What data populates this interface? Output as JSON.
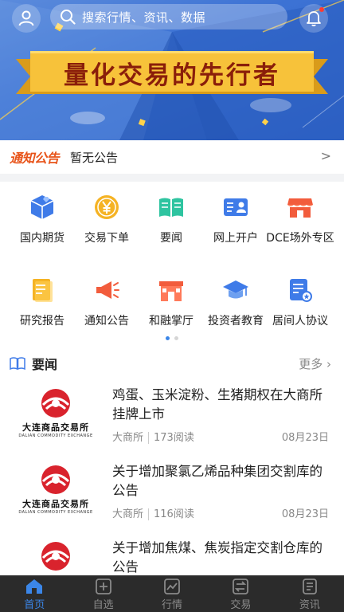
{
  "header": {
    "search_placeholder": "搜索行情、资讯、数据",
    "banner_slogan": "量化交易的先行者"
  },
  "notice": {
    "tag": "通知公告",
    "text": "暂无公告",
    "arrow": ">"
  },
  "menu": {
    "items": [
      {
        "label": "国内期货",
        "icon": "diamond-box-icon",
        "color": "#3f7be8"
      },
      {
        "label": "交易下单",
        "icon": "yen-coin-icon",
        "color": "#f5b324"
      },
      {
        "label": "要闻",
        "icon": "open-book-icon",
        "color": "#2ec4a0"
      },
      {
        "label": "网上开户",
        "icon": "id-card-icon",
        "color": "#3f7be8"
      },
      {
        "label": "DCE场外专区",
        "icon": "storefront-icon",
        "color": "#f25c3c"
      },
      {
        "label": "研究报告",
        "icon": "report-icon",
        "color": "#f5b324"
      },
      {
        "label": "通知公告",
        "icon": "megaphone-icon",
        "color": "#f25c3c"
      },
      {
        "label": "和融掌厅",
        "icon": "shop-hall-icon",
        "color": "#f25c3c"
      },
      {
        "label": "投资者教育",
        "icon": "graduation-cap-icon",
        "color": "#3f7be8"
      },
      {
        "label": "居间人协议",
        "icon": "agreement-icon",
        "color": "#3f7be8"
      }
    ],
    "page_count": 2,
    "active_page": 1
  },
  "news": {
    "section_title": "要闻",
    "more_label": "更多",
    "logo_cn": "大连商品交易所",
    "logo_en": "DALIAN COMMODITY EXCHANGE",
    "items": [
      {
        "title": "鸡蛋、玉米淀粉、生猪期权在大商所挂牌上市",
        "source": "大商所",
        "reads": "173阅读",
        "date": "08月23日"
      },
      {
        "title": "关于增加聚氯乙烯品种集团交割库的公告",
        "source": "大商所",
        "reads": "116阅读",
        "date": "08月23日"
      },
      {
        "title": "关于增加焦煤、焦炭指定交割仓库的公告",
        "source": "",
        "reads": "",
        "date": ""
      }
    ]
  },
  "tabbar": {
    "tabs": [
      {
        "label": "首页",
        "icon": "home-icon",
        "active": true
      },
      {
        "label": "自选",
        "icon": "add-square-icon",
        "active": false
      },
      {
        "label": "行情",
        "icon": "chart-line-icon",
        "active": false
      },
      {
        "label": "交易",
        "icon": "exchange-icon",
        "active": false
      },
      {
        "label": "资讯",
        "icon": "news-doc-icon",
        "active": false
      }
    ]
  },
  "colors": {
    "accent": "#3b86e8",
    "banner_blue": "#3c72d4",
    "ribbon_gold": "#f7c23a",
    "notice_orange": "#e8541a",
    "tabbar_bg": "#2b2b2b"
  }
}
